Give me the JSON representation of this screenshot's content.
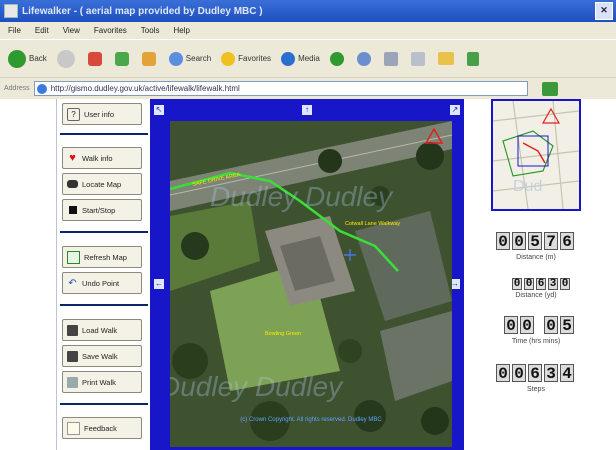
{
  "window": {
    "title": "Lifewalker - ( aerial map provided by Dudley MBC )"
  },
  "menu": [
    "File",
    "Edit",
    "View",
    "Favorites",
    "Tools",
    "Help"
  ],
  "toolbar": {
    "back_label": "Back",
    "search_label": "Search",
    "favorites_label": "Favorites",
    "media_label": "Media"
  },
  "address": {
    "label": "Address",
    "url": "http://gismo.dudley.gov.uk/active/lifewalk/lifewalk.html"
  },
  "left": {
    "buttons": [
      {
        "label": "User info",
        "icon": "question-icon"
      },
      {
        "label": "Walk info",
        "icon": "heart-icon"
      },
      {
        "label": "Locate Map",
        "icon": "car-icon"
      },
      {
        "label": "Start/Stop",
        "icon": "stop-icon"
      },
      {
        "label": "Refresh Map",
        "icon": "map-icon"
      },
      {
        "label": "Undo Point",
        "icon": "undo-icon"
      },
      {
        "label": "Load Walk",
        "icon": "floppy-icon"
      },
      {
        "label": "Save Walk",
        "icon": "floppy-icon"
      },
      {
        "label": "Print Walk",
        "icon": "print-icon"
      },
      {
        "label": "Feedback",
        "icon": "feedback-icon"
      }
    ]
  },
  "map": {
    "labels": [
      "SAFE DRIVE AREA",
      "Cotwall Lane Walkway",
      "Bowling Green"
    ],
    "watermark": "Dudley Dudley",
    "copyright": "(c) Crown Copyright. All rights reserved. Dudley MBC"
  },
  "stats": {
    "distance_m": {
      "digits": [
        "0",
        "0",
        "5",
        "7",
        "6"
      ],
      "label": "Distance (m)"
    },
    "distance_yd": {
      "digits": [
        "0",
        "0",
        "6",
        "3",
        "0"
      ],
      "label": "Distance (yd)"
    },
    "time": {
      "digits": [
        "0",
        "0",
        "0",
        "5"
      ],
      "label": "Time (hrs mins)"
    },
    "steps": {
      "digits": [
        "0",
        "0",
        "6",
        "3",
        "4"
      ],
      "label": "Steps"
    }
  },
  "colors": {
    "frame": "#1717c9",
    "walk_path": "#38e036",
    "sep": "#0a246a"
  }
}
